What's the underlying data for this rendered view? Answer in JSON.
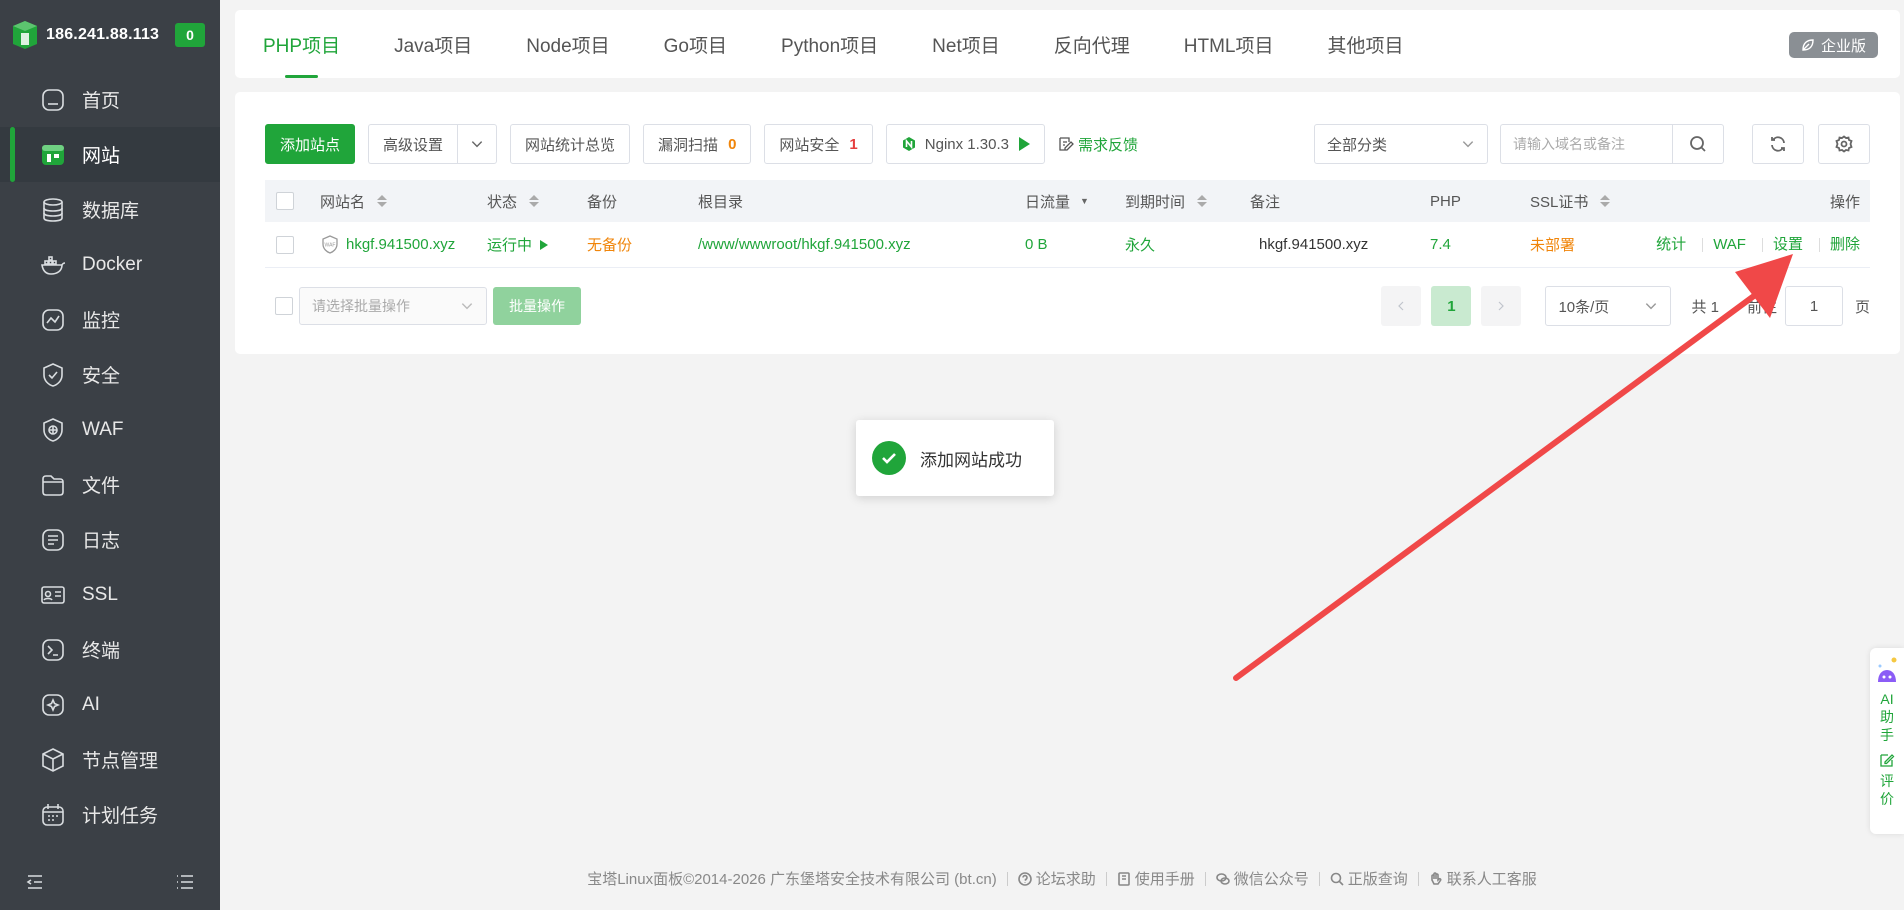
{
  "sidebar": {
    "ip": "186.241.88.113",
    "badge": "0",
    "items": [
      {
        "label": "首页",
        "icon": "home-icon"
      },
      {
        "label": "网站",
        "icon": "website-icon"
      },
      {
        "label": "数据库",
        "icon": "database-icon"
      },
      {
        "label": "Docker",
        "icon": "docker-icon"
      },
      {
        "label": "监控",
        "icon": "monitor-icon"
      },
      {
        "label": "安全",
        "icon": "shield-icon"
      },
      {
        "label": "WAF",
        "icon": "waf-icon"
      },
      {
        "label": "文件",
        "icon": "folder-icon"
      },
      {
        "label": "日志",
        "icon": "log-icon"
      },
      {
        "label": "SSL",
        "icon": "ssl-icon"
      },
      {
        "label": "终端",
        "icon": "terminal-icon"
      },
      {
        "label": "AI",
        "icon": "ai-icon"
      },
      {
        "label": "节点管理",
        "icon": "node-icon"
      },
      {
        "label": "计划任务",
        "icon": "calendar-icon"
      }
    ]
  },
  "tabs": [
    "PHP项目",
    "Java项目",
    "Node项目",
    "Go项目",
    "Python项目",
    "Net项目",
    "反向代理",
    "HTML项目",
    "其他项目"
  ],
  "enterprise_label": "企业版",
  "toolbar": {
    "add_site": "添加站点",
    "advanced": "高级设置",
    "stats_overview": "网站统计总览",
    "vuln_scan": "漏洞扫描",
    "vuln_count": "0",
    "site_security": "网站安全",
    "security_count": "1",
    "nginx": "Nginx 1.30.3",
    "feedback": "需求反馈",
    "category": "全部分类",
    "search_placeholder": "请输入域名或备注"
  },
  "table": {
    "headers": {
      "name": "网站名",
      "status": "状态",
      "backup": "备份",
      "root": "根目录",
      "traffic": "日流量",
      "expire": "到期时间",
      "note": "备注",
      "php": "PHP",
      "ssl": "SSL证书",
      "ops": "操作"
    },
    "rows": [
      {
        "name": "hkgf.941500.xyz",
        "status": "运行中",
        "backup": "无备份",
        "root": "/www/wwwroot/hkgf.941500.xyz",
        "traffic": "0 B",
        "expire": "永久",
        "note": "hkgf.941500.xyz",
        "php": "7.4",
        "ssl": "未部署",
        "ops": [
          "统计",
          "WAF",
          "设置",
          "删除"
        ]
      }
    ]
  },
  "batch": {
    "select_placeholder": "请选择批量操作",
    "button": "批量操作"
  },
  "pager": {
    "current": "1",
    "per_page": "10条/页",
    "total_prefix": "共 1",
    "goto_suffix": "前往",
    "goto_value": "1",
    "page_unit": "页"
  },
  "toast": "添加网站成功",
  "ai_float": {
    "ai_label": "AI助手",
    "rate_label": "评价"
  },
  "footer": {
    "copyright": "宝塔Linux面板©2014-2026 广东堡塔安全技术有限公司 (bt.cn)",
    "links": [
      "论坛求助",
      "使用手册",
      "微信公众号",
      "正版查询",
      "联系人工客服"
    ]
  },
  "colors": {
    "accent": "#20a53a",
    "sidebar_bg": "#3b4046",
    "annotation_arrow": "#f04848"
  }
}
